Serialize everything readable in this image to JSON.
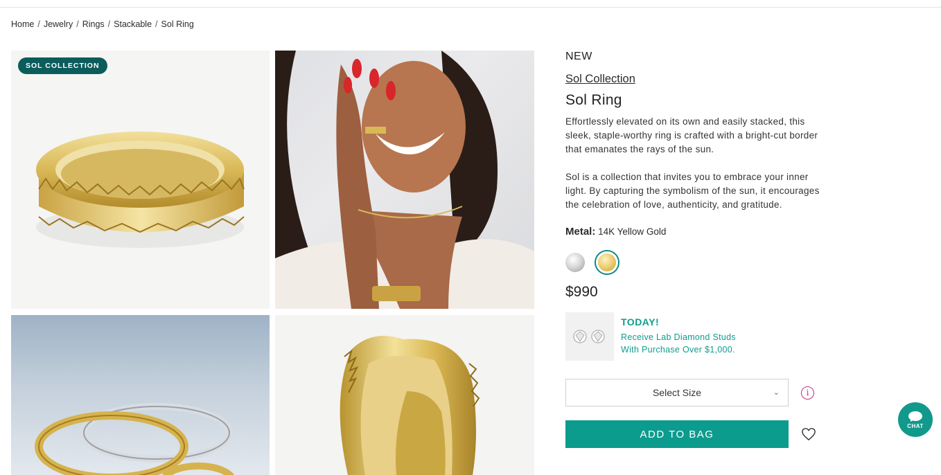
{
  "breadcrumb": [
    "Home",
    "Jewelry",
    "Rings",
    "Stackable",
    "Sol Ring"
  ],
  "breadcrumb_separator": "/",
  "gallery": {
    "badge": "SOL COLLECTION"
  },
  "product": {
    "new_label": "NEW",
    "collection_link": "Sol Collection",
    "title": "Sol Ring",
    "description_1": "Effortlessly elevated on its own and easily stacked, this sleek, staple-worthy ring is crafted with a bright-cut border that emanates the rays of the sun.",
    "description_2": "Sol is a collection that invites you to embrace your inner light. By capturing the symbolism of the sun, it encourages the celebration of love, authenticity, and gratitude.",
    "metal_label": "Metal:",
    "metal_value": "14K Yellow Gold",
    "swatches": [
      {
        "name": "white-gold",
        "selected": false
      },
      {
        "name": "yellow-gold",
        "selected": true
      }
    ],
    "price": "$990"
  },
  "promo": {
    "headline": "TODAY!",
    "line1": "Receive Lab Diamond Studs",
    "line2": "With Purchase Over $1,000."
  },
  "size_select": {
    "label": "Select Size",
    "chevron": "⌄"
  },
  "add_to_bag": "ADD TO BAG",
  "chat": {
    "label": "CHAT"
  },
  "colors": {
    "accent": "#0c9c8e",
    "badge": "#0b5d5c",
    "info_icon": "#c3327a"
  }
}
